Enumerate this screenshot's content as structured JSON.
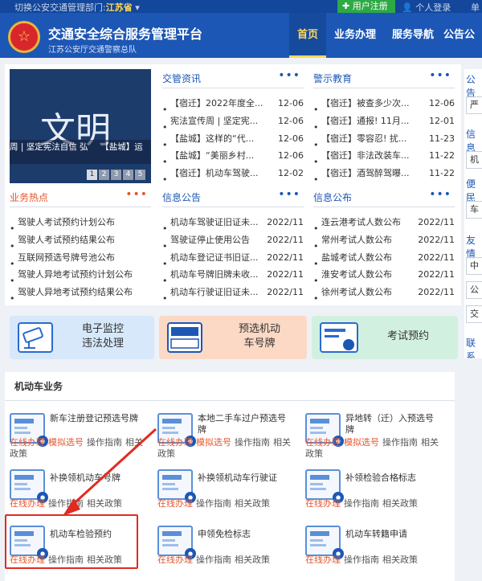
{
  "topbar": {
    "switch_label": "切换公安交通管理部门:",
    "province": "江苏省",
    "register": "用户注册",
    "login": "个人登录",
    "mobile": "单"
  },
  "header": {
    "title": "交通安全综合服务管理平台",
    "subtitle": "江苏公安厅交通警察总队",
    "emblem": "☆"
  },
  "nav": [
    "首页",
    "业务办理",
    "服务导航",
    "公告公"
  ],
  "slider": {
    "big_text": "文明",
    "caption": "周 | 坚定宪法自信 弘　　【盐城】运　原...",
    "pages": [
      "1",
      "2",
      "3",
      "4",
      "5"
    ]
  },
  "news": {
    "title": "交管资讯",
    "more": "•••",
    "items": [
      {
        "t": "【宿迁】2022年度全...",
        "d": "12-06"
      },
      {
        "t": "宪法宣传周 | 坚定宪...",
        "d": "12-06"
      },
      {
        "t": "【盐城】这样的“代...",
        "d": "12-06"
      },
      {
        "t": "【盐城】“美丽乡村...",
        "d": "12-06"
      },
      {
        "t": "【宿迁】机动车驾驶...",
        "d": "12-02"
      }
    ]
  },
  "warn": {
    "title": "警示教育",
    "more": "•••",
    "items": [
      {
        "t": "【宿迁】被查多少次...",
        "d": "12-06"
      },
      {
        "t": "【宿迁】通报! 11月...",
        "d": "12-01"
      },
      {
        "t": "【宿迁】零容忍! 扰...",
        "d": "11-23"
      },
      {
        "t": "【宿迁】非法改装车...",
        "d": "11-22"
      },
      {
        "t": "【宿迁】酒驾醉驾曝...",
        "d": "11-22"
      }
    ]
  },
  "hot": {
    "title": "业务热点",
    "more": "•••",
    "items": [
      "驾驶人考试预约计划公布",
      "驾驶人考试预约结果公布",
      "互联网预选号牌号池公布",
      "驾驶人异地考试预约计划公布",
      "驾驶人异地考试预约结果公布"
    ]
  },
  "notice": {
    "title": "信息公告",
    "more": "•••",
    "items": [
      {
        "t": "机动车驾驶证旧证未...",
        "d": "2022/11"
      },
      {
        "t": "驾驶证停止使用公告",
        "d": "2022/11"
      },
      {
        "t": "机动车登记证书旧证...",
        "d": "2022/11"
      },
      {
        "t": "机动车号牌旧牌未收...",
        "d": "2022/11"
      },
      {
        "t": "机动车行驶证旧证未...",
        "d": "2022/11"
      }
    ]
  },
  "publish": {
    "title": "信息公布",
    "more": "•••",
    "items": [
      {
        "t": "连云港考试人数公布",
        "d": "2022/11"
      },
      {
        "t": "常州考试人数公布",
        "d": "2022/11"
      },
      {
        "t": "盐城考试人数公布",
        "d": "2022/11"
      },
      {
        "t": "淮安考试人数公布",
        "d": "2022/11"
      },
      {
        "t": "徐州考试人数公布",
        "d": "2022/11"
      }
    ]
  },
  "sidebar": {
    "h1": "公告",
    "b1": "严",
    "h2": "信息",
    "b2": "机",
    "h3": "便民",
    "b3": "车",
    "h4": "友情",
    "b4": "中",
    "b5": "公",
    "b6": "交",
    "h5": "联系"
  },
  "cards": [
    {
      "label": "电子监控\n违法处理",
      "color": "#d6e8fa",
      "icon": "camera-icon"
    },
    {
      "label": "预选机动\n车号牌",
      "color": "#fcd9c4",
      "icon": "plate-icon"
    },
    {
      "label": "考试预约",
      "color": "#d2f0df",
      "icon": "exam-icon"
    }
  ],
  "section": {
    "title": "机动车业务"
  },
  "services": [
    {
      "name": "新车注册登记预选号牌",
      "links": [
        "在线办理",
        "模拟选号",
        "操作指南",
        "相关"
      ],
      "extra": "政策"
    },
    {
      "name": "本地二手车过户预选号牌",
      "links": [
        "在线办理",
        "模拟选号",
        "操作指南",
        "相关"
      ],
      "extra": "政策"
    },
    {
      "name": "异地转（迁）入预选号牌",
      "links": [
        "在线办理",
        "模拟选号",
        "操作指南",
        "相关"
      ],
      "extra": "政策"
    },
    {
      "name": "补换领机动车号牌",
      "links": [
        "在线办理",
        "操作指南",
        "相关政策"
      ]
    },
    {
      "name": "补换领机动车行驶证",
      "links": [
        "在线办理",
        "操作指南",
        "相关政策"
      ]
    },
    {
      "name": "补领检验合格标志",
      "links": [
        "在线办理",
        "操作指南",
        "相关政策"
      ]
    },
    {
      "name": "机动车检验预约",
      "links": [
        "在线办理",
        "操作指南",
        "相关政策"
      ]
    },
    {
      "name": "申领免检标志",
      "links": [
        "在线办理",
        "操作指南",
        "相关政策"
      ]
    },
    {
      "name": "机动车转籍申请",
      "links": [
        "在线办理",
        "操作指南",
        "相关政策"
      ]
    }
  ],
  "colors": {
    "header": "#1d57b5",
    "accent": "#e4572e",
    "highlight": "#e12b22"
  }
}
